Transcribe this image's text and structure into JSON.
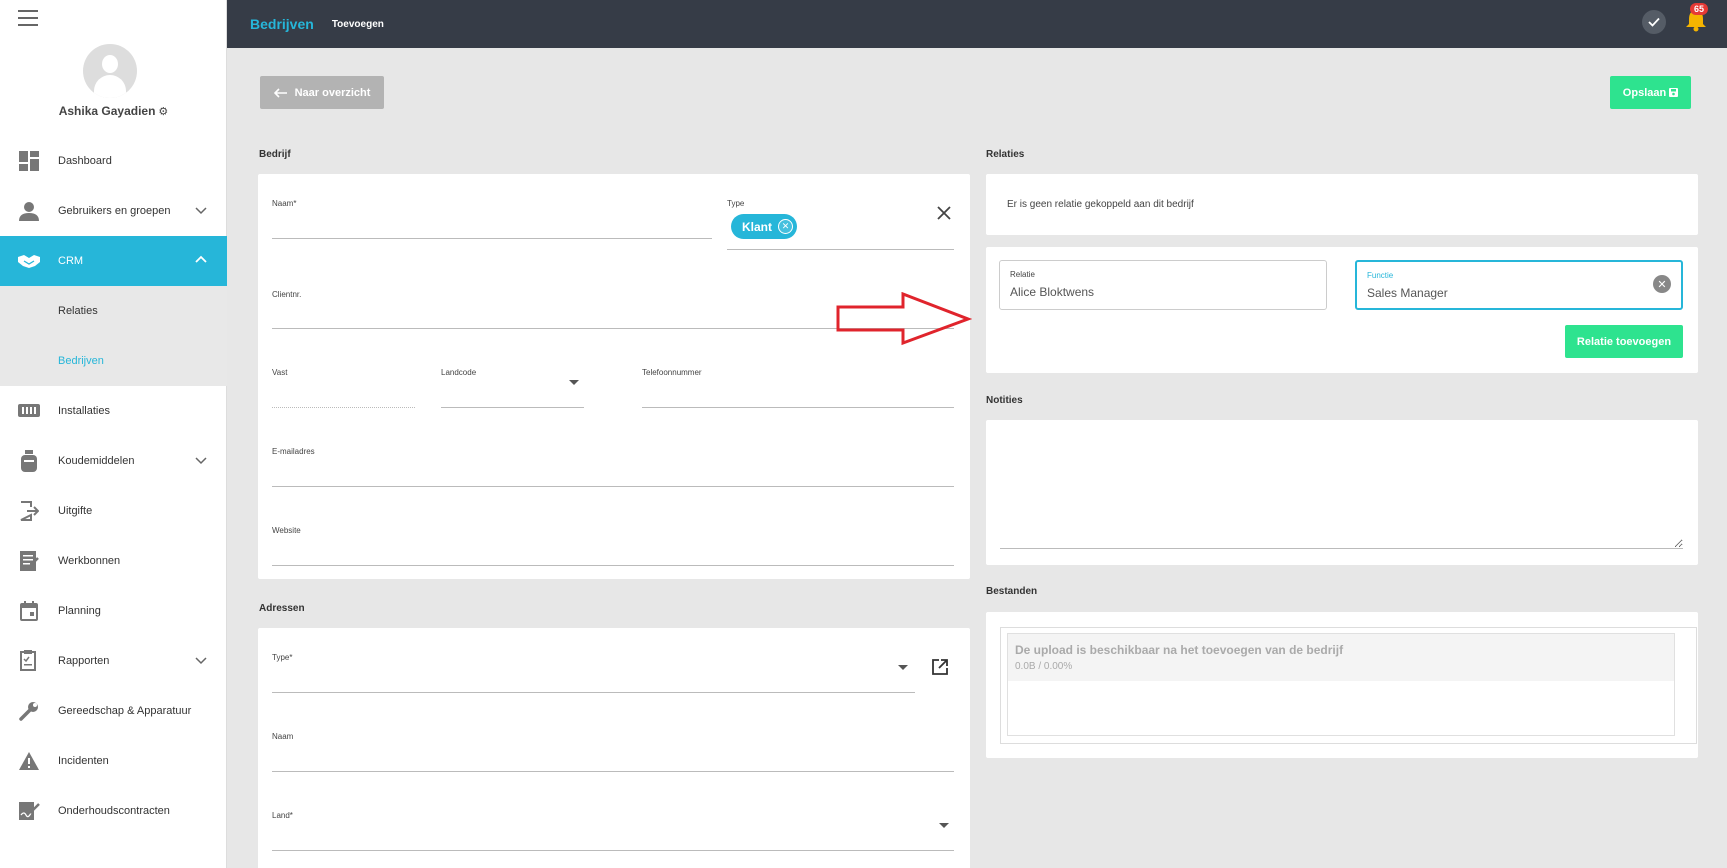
{
  "sidebar": {
    "user_name": "Ashika Gayadien",
    "items": [
      {
        "label": "Dashboard"
      },
      {
        "label": "Gebruikers en groepen"
      },
      {
        "label": "CRM"
      },
      {
        "label": "Relaties"
      },
      {
        "label": "Bedrijven"
      },
      {
        "label": "Installaties"
      },
      {
        "label": "Koudemiddelen"
      },
      {
        "label": "Uitgifte"
      },
      {
        "label": "Werkbonnen"
      },
      {
        "label": "Planning"
      },
      {
        "label": "Rapporten"
      },
      {
        "label": "Gereedschap & Apparatuur"
      },
      {
        "label": "Incidenten"
      },
      {
        "label": "Onderhoudscontracten"
      }
    ]
  },
  "header": {
    "title": "Bedrijven",
    "breadcrumb": "Toevoegen",
    "notification_count": "65"
  },
  "toolbar": {
    "back_label": "Naar overzicht",
    "save_label": "Opslaan"
  },
  "bedrijf": {
    "section_title": "Bedrijf",
    "naam_label": "Naam*",
    "type_label": "Type",
    "type_chip": "Klant",
    "clientnr_label": "Clientnr.",
    "vast_label": "Vast",
    "landcode_label": "Landcode",
    "telefoon_label": "Telefoonnummer",
    "email_label": "E-mailadres",
    "website_label": "Website"
  },
  "adressen": {
    "section_title": "Adressen",
    "type_label": "Type*",
    "naam_label": "Naam",
    "land_label": "Land*"
  },
  "relaties": {
    "section_title": "Relaties",
    "empty_text": "Er is geen relatie gekoppeld aan dit bedrijf",
    "relatie_label": "Relatie",
    "relatie_value": "Alice Bloktwens",
    "functie_label": "Functie",
    "functie_value": "Sales Manager",
    "add_button": "Relatie toevoegen"
  },
  "notities": {
    "section_title": "Notities"
  },
  "bestanden": {
    "section_title": "Bestanden",
    "upload_text": "De upload is beschikbaar na het toevoegen van de bedrijf",
    "upload_meta": "0.0B / 0.00%"
  },
  "colors": {
    "accent": "#26b6d9",
    "success": "#2ee38f",
    "topbar": "#363c47",
    "annotation_arrow": "#e0242c"
  }
}
